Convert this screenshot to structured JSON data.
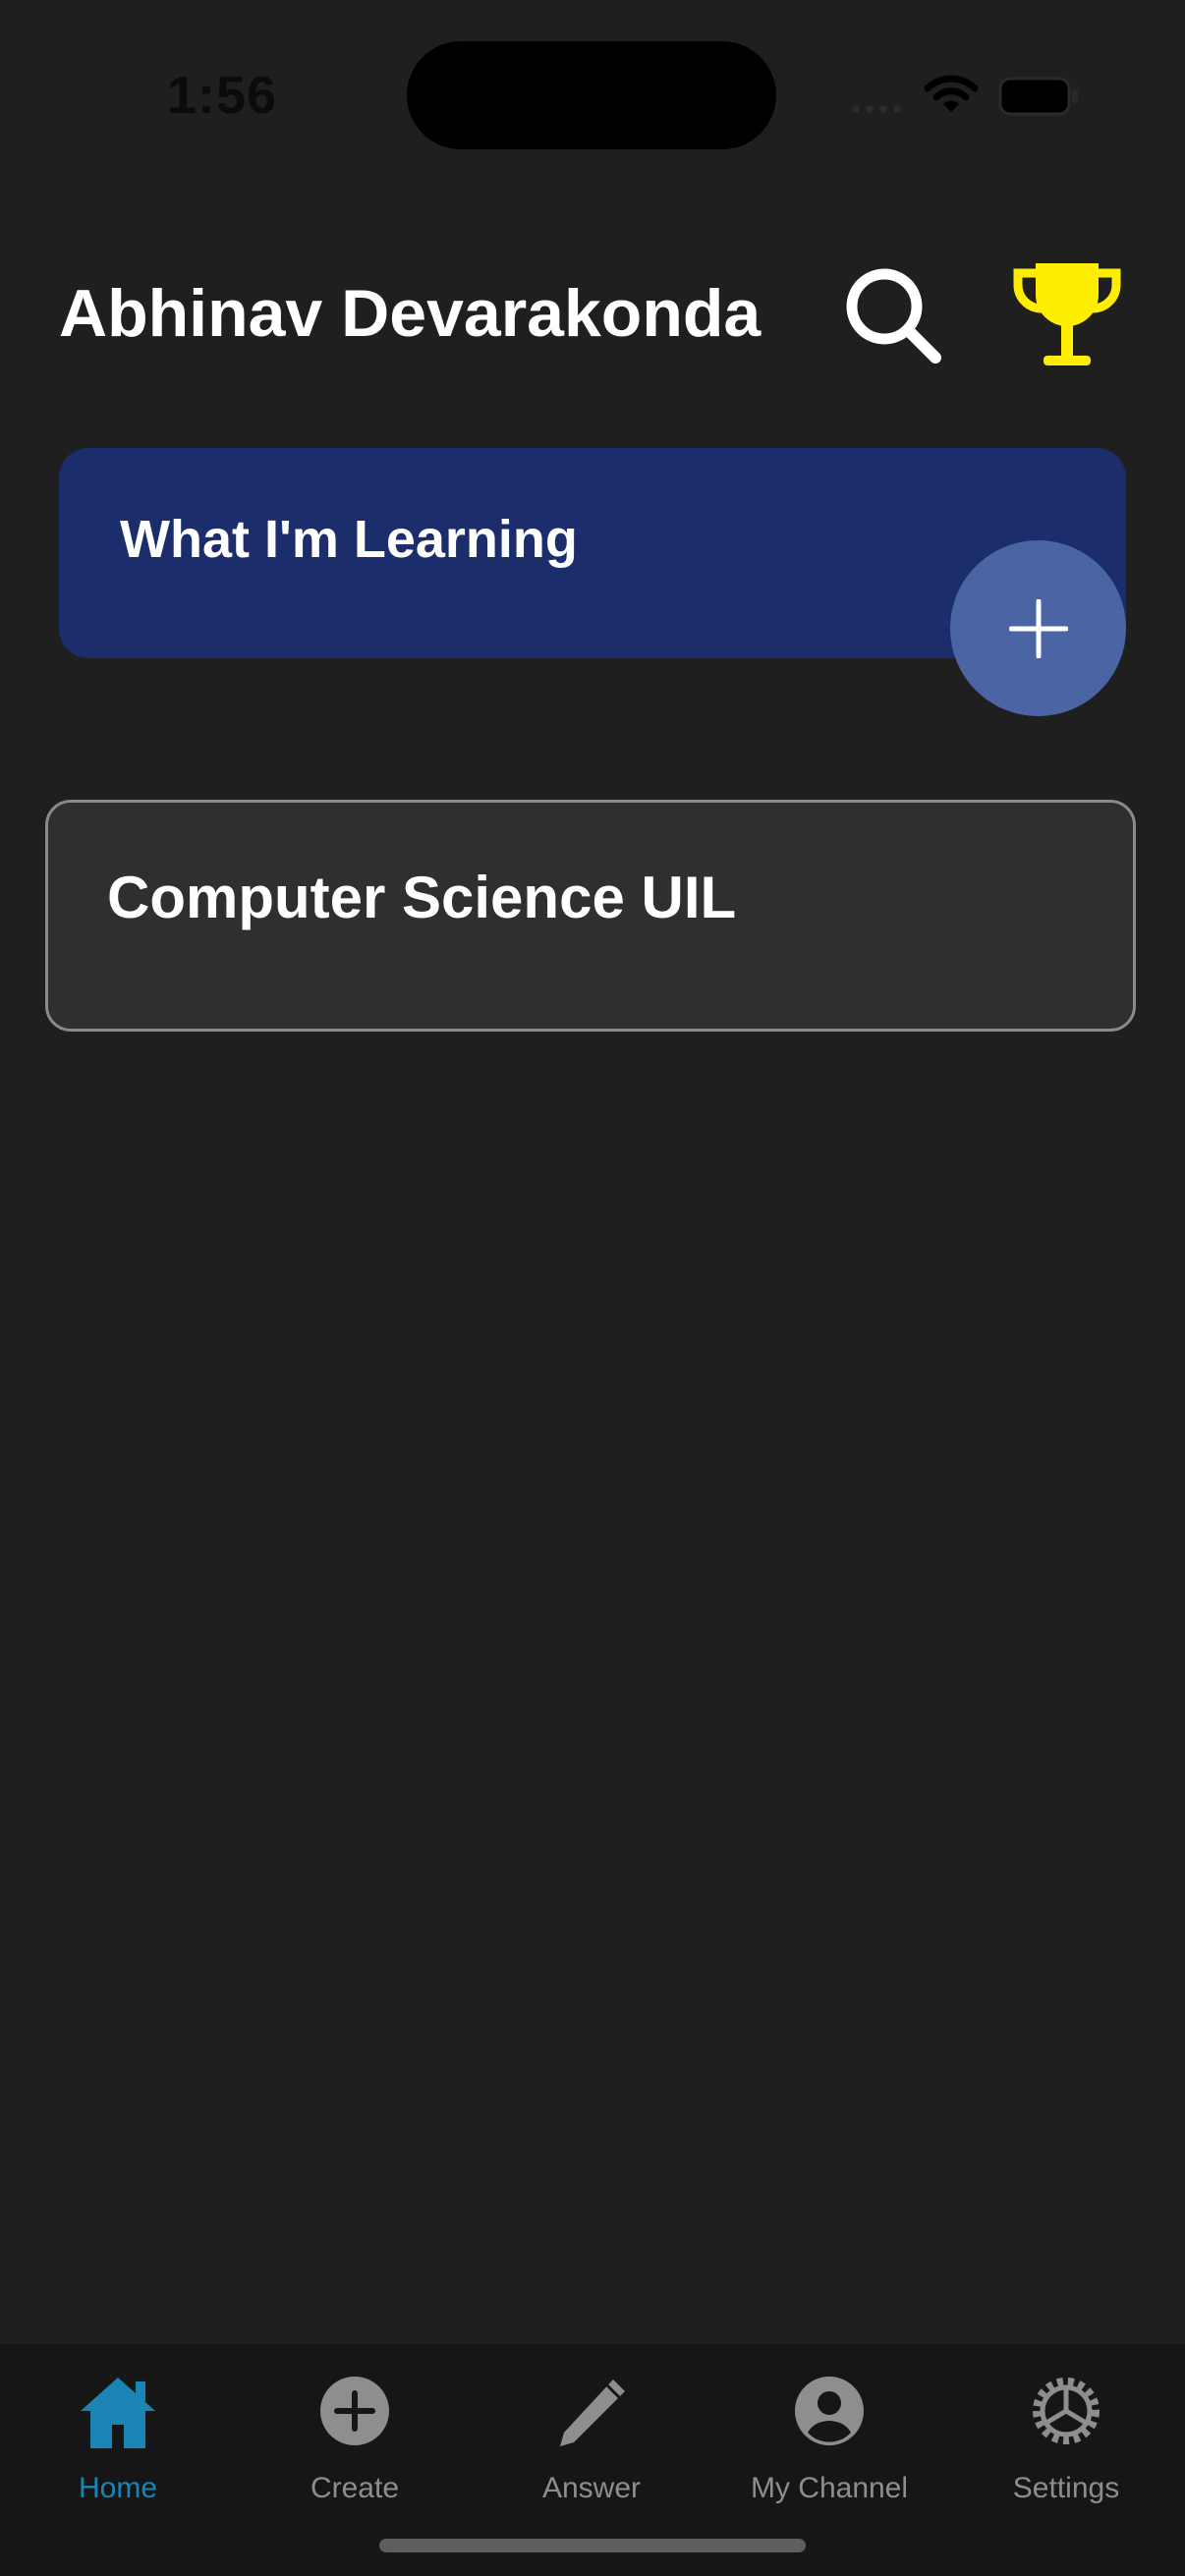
{
  "status_bar": {
    "time": "1:56"
  },
  "header": {
    "title": "Abhinav Devarakonda"
  },
  "icons": {
    "search": "search-icon",
    "trophy": "trophy-icon",
    "add": "plus-icon",
    "trophy_color": "#ffee00"
  },
  "learning_section": {
    "title": "What I'm Learning"
  },
  "courses": [
    {
      "title": "Computer Science UIL"
    }
  ],
  "tab_bar": {
    "tabs": [
      {
        "label": "Home",
        "icon": "home-icon",
        "active": true
      },
      {
        "label": "Create",
        "icon": "plus-circle-icon",
        "active": false
      },
      {
        "label": "Answer",
        "icon": "pencil-icon",
        "active": false
      },
      {
        "label": "My Channel",
        "icon": "person-circle-icon",
        "active": false
      },
      {
        "label": "Settings",
        "icon": "gear-icon",
        "active": false
      }
    ]
  },
  "colors": {
    "background": "#1f1f1f",
    "banner": "#1b2d6b",
    "fab": "#4a64a4",
    "active_tab": "#1a85b4",
    "inactive_tab": "#8e8e8e"
  }
}
